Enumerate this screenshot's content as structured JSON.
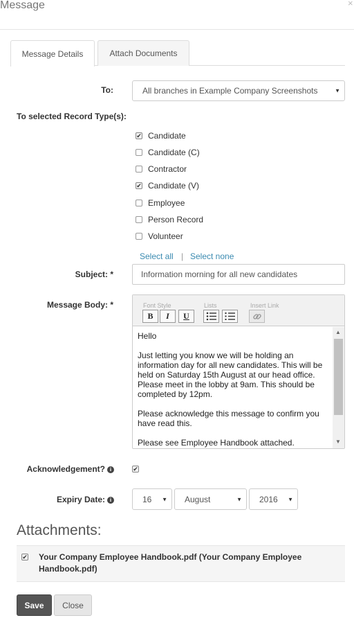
{
  "modal": {
    "title": "Message",
    "close_glyph": "×"
  },
  "tabs": [
    {
      "label": "Message Details",
      "active": true
    },
    {
      "label": "Attach Documents",
      "active": false
    }
  ],
  "to": {
    "label": "To:",
    "selected": "All branches in Example Company Screenshots",
    "caret_glyph": "▼"
  },
  "record_types": {
    "label": "To selected Record Type(s):",
    "items": [
      {
        "label": "Candidate",
        "checked": true
      },
      {
        "label": "Candidate (C)",
        "checked": false
      },
      {
        "label": "Contractor",
        "checked": false
      },
      {
        "label": "Candidate (V)",
        "checked": true
      },
      {
        "label": "Employee",
        "checked": false
      },
      {
        "label": "Person Record",
        "checked": false
      },
      {
        "label": "Volunteer",
        "checked": false
      }
    ],
    "select_all": "Select all",
    "separator": "|",
    "select_none": "Select none"
  },
  "subject": {
    "label": "Subject: *",
    "value": "Information morning for all new candidates"
  },
  "message_body": {
    "label": "Message Body: *",
    "toolbar": {
      "font_style_label": "Font Style",
      "lists_label": "Lists",
      "insert_link_label": "Insert Link",
      "bold": "B",
      "italic": "I",
      "underline": "U"
    },
    "content": "Hello\n\nJust letting you know we will be holding an information day for all new candidates.  This will be held on Saturday 15th August at our head office. Please meet in the lobby at 9am.  This should be completed by 12pm.\n\nPlease acknowledge this message to confirm you have read this.\n\nPlease see Employee Handbook attached.",
    "scroll_up": "▲",
    "scroll_down": "▼"
  },
  "acknowledgement": {
    "label": "Acknowledgement?",
    "info_glyph": "i",
    "checked": true
  },
  "expiry": {
    "label": "Expiry Date:",
    "info_glyph": "i",
    "day": "16",
    "month": "August",
    "year": "2016",
    "caret_glyph": "▼"
  },
  "attachments": {
    "title": "Attachments:",
    "items": [
      {
        "text": "Your Company Employee Handbook.pdf (Your Company Employee Handbook.pdf)",
        "checked": true
      }
    ]
  },
  "buttons": {
    "save": "Save",
    "close": "Close"
  },
  "check_glyph": "✔"
}
